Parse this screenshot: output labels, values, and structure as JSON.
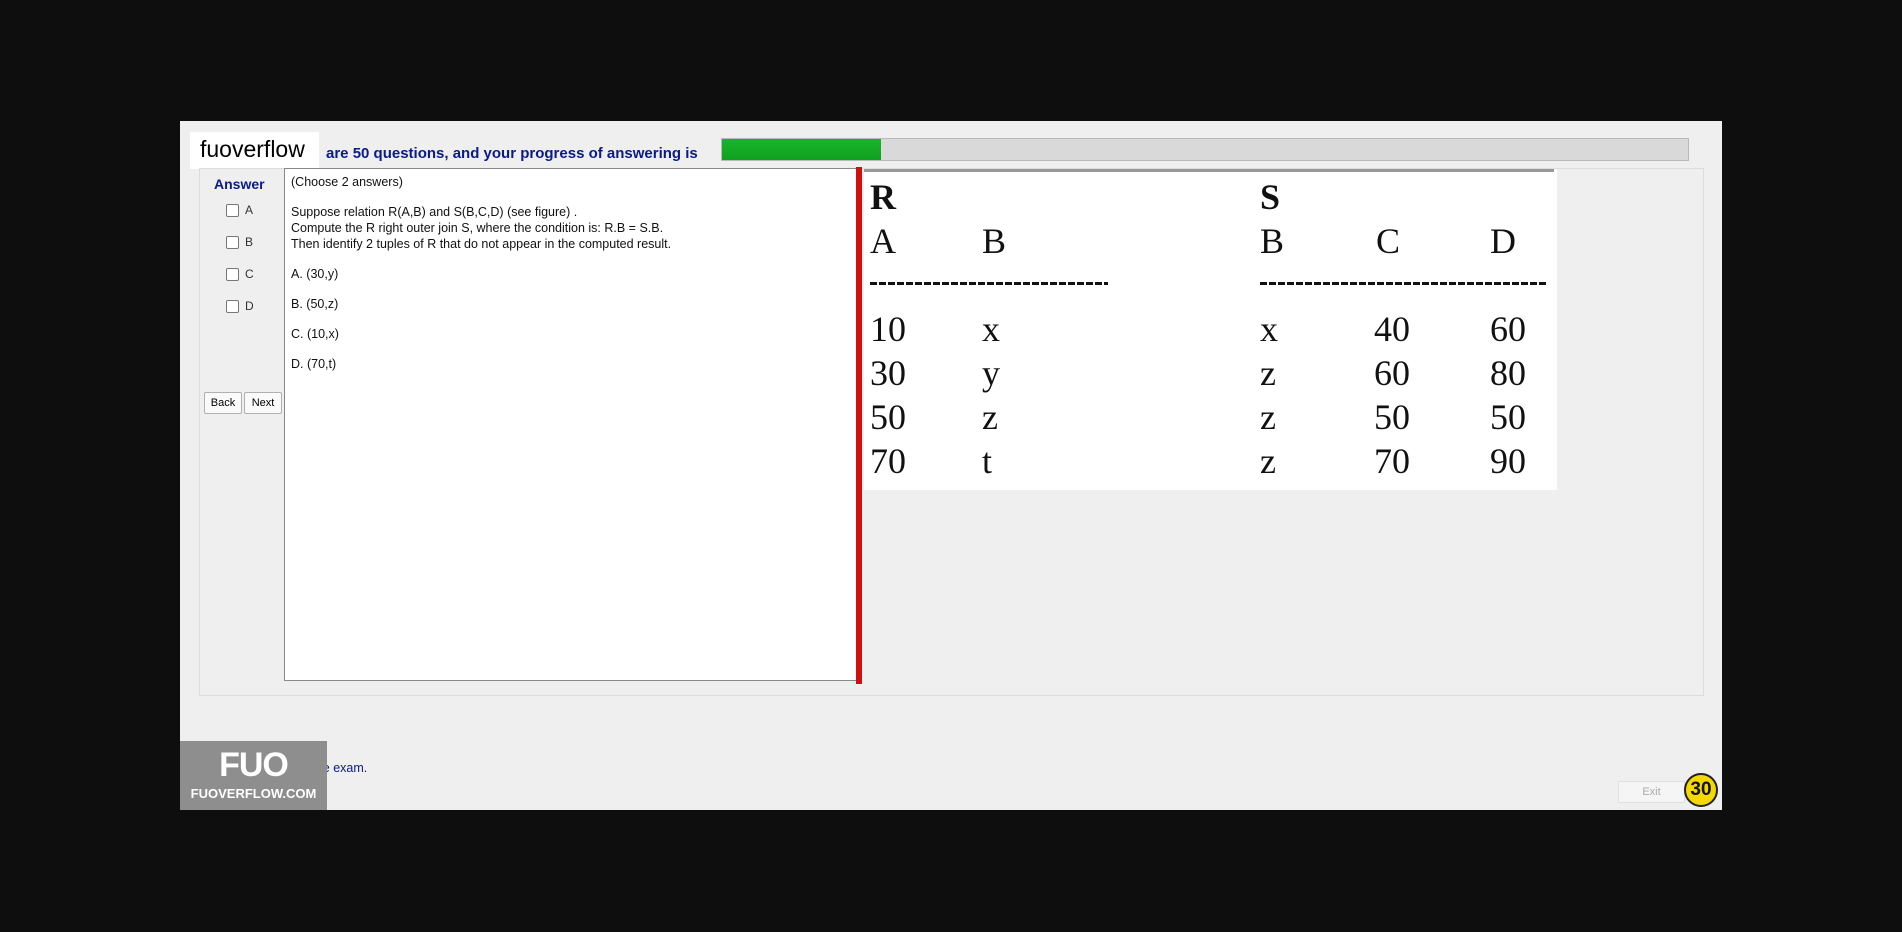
{
  "app": {
    "brand": "fuoverflow"
  },
  "progress": {
    "label": "are 50 questions, and your progress of answering is",
    "value_percent": 16.5
  },
  "answer_panel": {
    "title": "Answer",
    "options": [
      "A",
      "B",
      "C",
      "D"
    ],
    "back_label": "Back",
    "next_label": "Next"
  },
  "question": {
    "instruction": "(Choose 2 answers)",
    "lines": [
      "Suppose relation R(A,B) and S(B,C,D)  (see figure) .",
      "Compute the R right outer join S, where the condition is: R.B = S.B.",
      "Then identify 2 tuples of R that do not appear in the computed result."
    ],
    "choices": [
      "A.  (30,y)",
      "B.  (50,z)",
      "C.  (10,x)",
      "D.  (70,t)"
    ]
  },
  "figure": {
    "r_name": "R",
    "s_name": "S",
    "r_headers": [
      "A",
      "B"
    ],
    "s_headers": [
      "B",
      "C",
      "D"
    ],
    "r_rows": [
      [
        "10",
        "x"
      ],
      [
        "30",
        "y"
      ],
      [
        "50",
        "z"
      ],
      [
        "70",
        "t"
      ]
    ],
    "s_rows": [
      [
        "x",
        "40",
        "60"
      ],
      [
        "z",
        "60",
        "80"
      ],
      [
        "z",
        "50",
        "50"
      ],
      [
        "z",
        "70",
        "90"
      ]
    ]
  },
  "footer": {
    "finish_label": "I want to finish the exam.",
    "exit_label": "Exit",
    "timer": "30",
    "watermark_top": "FUO",
    "watermark_bottom": "FUOVERFLOW.COM"
  },
  "colors": {
    "accent": "#0a1a8a",
    "progress": "#19b42a",
    "divider": "#d01010",
    "timer_bg": "#f5d800"
  }
}
